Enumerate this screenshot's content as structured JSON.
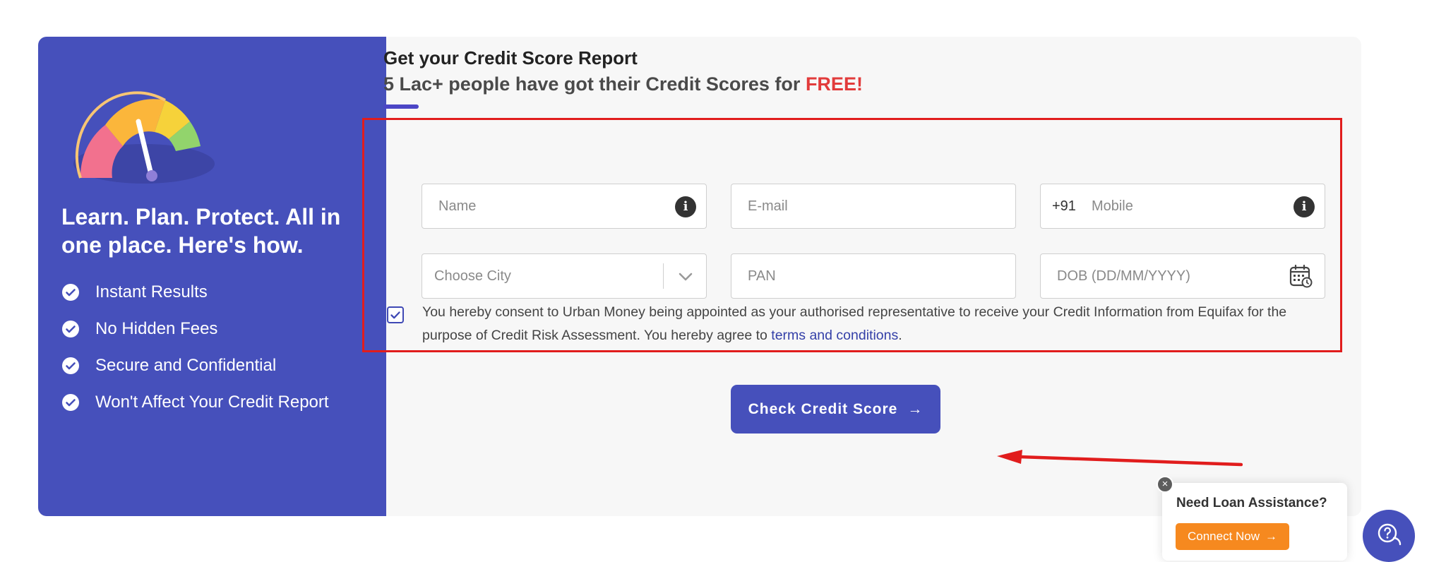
{
  "promo": {
    "headline": "Learn. Plan. Protect. All in one place. Here's how.",
    "features": [
      "Instant Results",
      "No Hidden Fees",
      "Secure and Confidential",
      "Won't Affect Your Credit Report"
    ]
  },
  "form": {
    "title": "Get your Credit Score Report",
    "subtitle": "5 Lac+ people have got their Credit Scores for",
    "subtitle_highlight": "FREE!",
    "fields": {
      "name_placeholder": "Name",
      "email_placeholder": "E-mail",
      "mobile_prefix": "+91",
      "mobile_placeholder": "Mobile",
      "city_placeholder": "Choose City",
      "pan_placeholder": "PAN",
      "dob_placeholder": "DOB (DD/MM/YYYY)"
    },
    "consent": {
      "checked": true,
      "text": "You hereby consent to Urban Money being appointed as your authorised representative to receive your Credit Information from Equifax for the purpose of Credit Risk Assessment. You hereby agree to",
      "link_text": "terms and conditions",
      "trailing": "."
    },
    "submit_label": "Check Credit Score",
    "submit_arrow": "→"
  },
  "help_widget": {
    "title": "Need Loan Assistance?",
    "cta_label": "Connect Now",
    "cta_arrow": "→",
    "close_glyph": "×"
  },
  "icons": {
    "info": "i"
  },
  "colors": {
    "brand": "#4650bb",
    "highlight": "#e11d1d",
    "free": "#e23b3b",
    "cta_orange": "#f6891f"
  }
}
